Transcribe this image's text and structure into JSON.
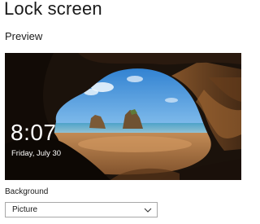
{
  "page": {
    "title": "Lock screen"
  },
  "preview": {
    "heading": "Preview",
    "time": "8:07",
    "date": "Friday, July 30"
  },
  "background": {
    "label": "Background",
    "selected": "Picture",
    "icon": "chevron-down-icon"
  }
}
